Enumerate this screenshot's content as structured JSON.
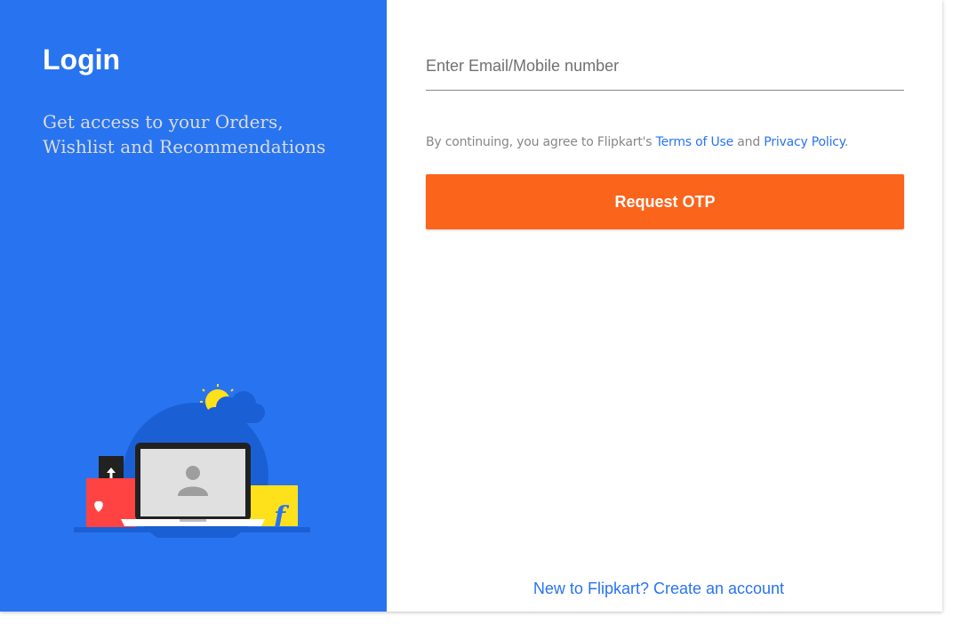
{
  "login_panel": {
    "title": "Login",
    "subtitle": "Get access to your Orders, Wishlist and Recommendations"
  },
  "form": {
    "identifier_placeholder": "Enter Email/Mobile number",
    "identifier_value": "",
    "terms_prefix": "By continuing, you agree to Flipkart's ",
    "terms_link": "Terms of Use",
    "terms_and": " and ",
    "privacy_link": "Privacy Policy",
    "terms_suffix": ".",
    "submit_label": "Request OTP"
  },
  "footer": {
    "signup_label": "New to Flipkart? Create an account"
  },
  "colors": {
    "brand_blue": "#2874f0",
    "action_orange": "#fb641b"
  }
}
